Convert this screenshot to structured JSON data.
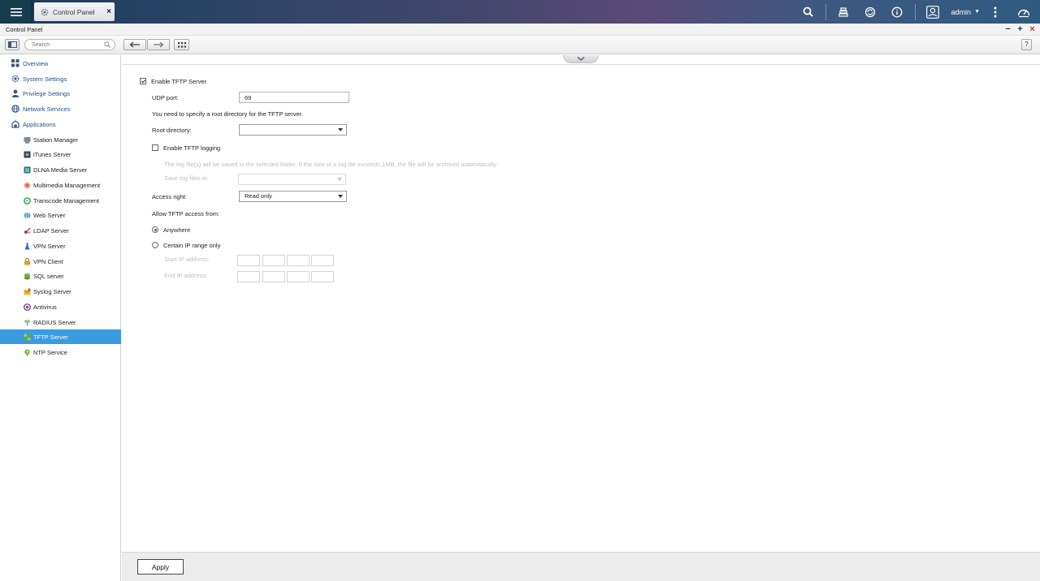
{
  "topbar": {
    "app_tab_label": "Control Panel",
    "app_tab_close": "×",
    "user_name": "admin",
    "user_caret": "▼"
  },
  "window": {
    "title": "Control Panel",
    "minimize": "−",
    "maximize": "+",
    "close": "×"
  },
  "toolbar": {
    "search_placeholder": "Search",
    "help": "?"
  },
  "sidebar": {
    "sections": [
      {
        "label": "Overview",
        "icon": "grid-icon"
      },
      {
        "label": "System Settings",
        "icon": "gear-icon"
      },
      {
        "label": "Privilege Settings",
        "icon": "user-icon"
      },
      {
        "label": "Network Services",
        "icon": "globe-icon"
      },
      {
        "label": "Applications",
        "icon": "apps-icon"
      }
    ],
    "items": [
      {
        "label": "Station Manager",
        "icon": "station-manager-icon",
        "color": "#6b7d8e"
      },
      {
        "label": "iTunes Server",
        "icon": "itunes-server-icon",
        "color": "#555555"
      },
      {
        "label": "DLNA Media Server",
        "icon": "dlna-icon",
        "color": "#3a8a3a"
      },
      {
        "label": "Multimedia Management",
        "icon": "multimedia-icon",
        "color": "#e06a4a"
      },
      {
        "label": "Transcode Management",
        "icon": "transcode-icon",
        "color": "#2aa85a"
      },
      {
        "label": "Web Server",
        "icon": "web-server-icon",
        "color": "#2a8ad0"
      },
      {
        "label": "LDAP Server",
        "icon": "ldap-icon",
        "color": "#5a4aa0"
      },
      {
        "label": "VPN Server",
        "icon": "vpn-server-icon",
        "color": "#2a6ad0"
      },
      {
        "label": "VPN Client",
        "icon": "vpn-client-icon",
        "color": "#d89a20"
      },
      {
        "label": "SQL server",
        "icon": "sql-icon",
        "color": "#7aa83a"
      },
      {
        "label": "Syslog Server",
        "icon": "syslog-icon",
        "color": "#e0a020"
      },
      {
        "label": "Antivirus",
        "icon": "antivirus-icon",
        "color": "#3a3aa0"
      },
      {
        "label": "RADIUS Server",
        "icon": "radius-icon",
        "color": "#3aa03a"
      },
      {
        "label": "TFTP Server",
        "icon": "tftp-icon",
        "color": "#3aa03a",
        "active": true
      },
      {
        "label": "NTP Service",
        "icon": "ntp-icon",
        "color": "#5ab02a"
      }
    ]
  },
  "form": {
    "enable_tftp_label": "Enable TFTP Server",
    "enable_tftp_checked": true,
    "udp_port_label": "UDP port:",
    "udp_port_value": "69",
    "root_dir_note": "You need to specify a root directory for the TFTP server.",
    "root_dir_label": "Root directory:",
    "root_dir_value": "",
    "enable_logging_label": "Enable TFTP logging",
    "enable_logging_checked": false,
    "log_note": "The log file(s) will be saved in the selected folder. If the size of a log file exceeds 1MB, the file will be archived automatically.",
    "save_log_label": "Save log files in:",
    "access_right_label": "Access right:",
    "access_right_value": "Read only",
    "allow_access_label": "Allow TFTP access from:",
    "anywhere_label": "Anywhere",
    "certain_ip_label": "Certain IP range only",
    "start_ip_label": "Start IP address:",
    "end_ip_label": "End IP address:",
    "ip_separator": "."
  },
  "footer": {
    "apply_label": "Apply"
  }
}
